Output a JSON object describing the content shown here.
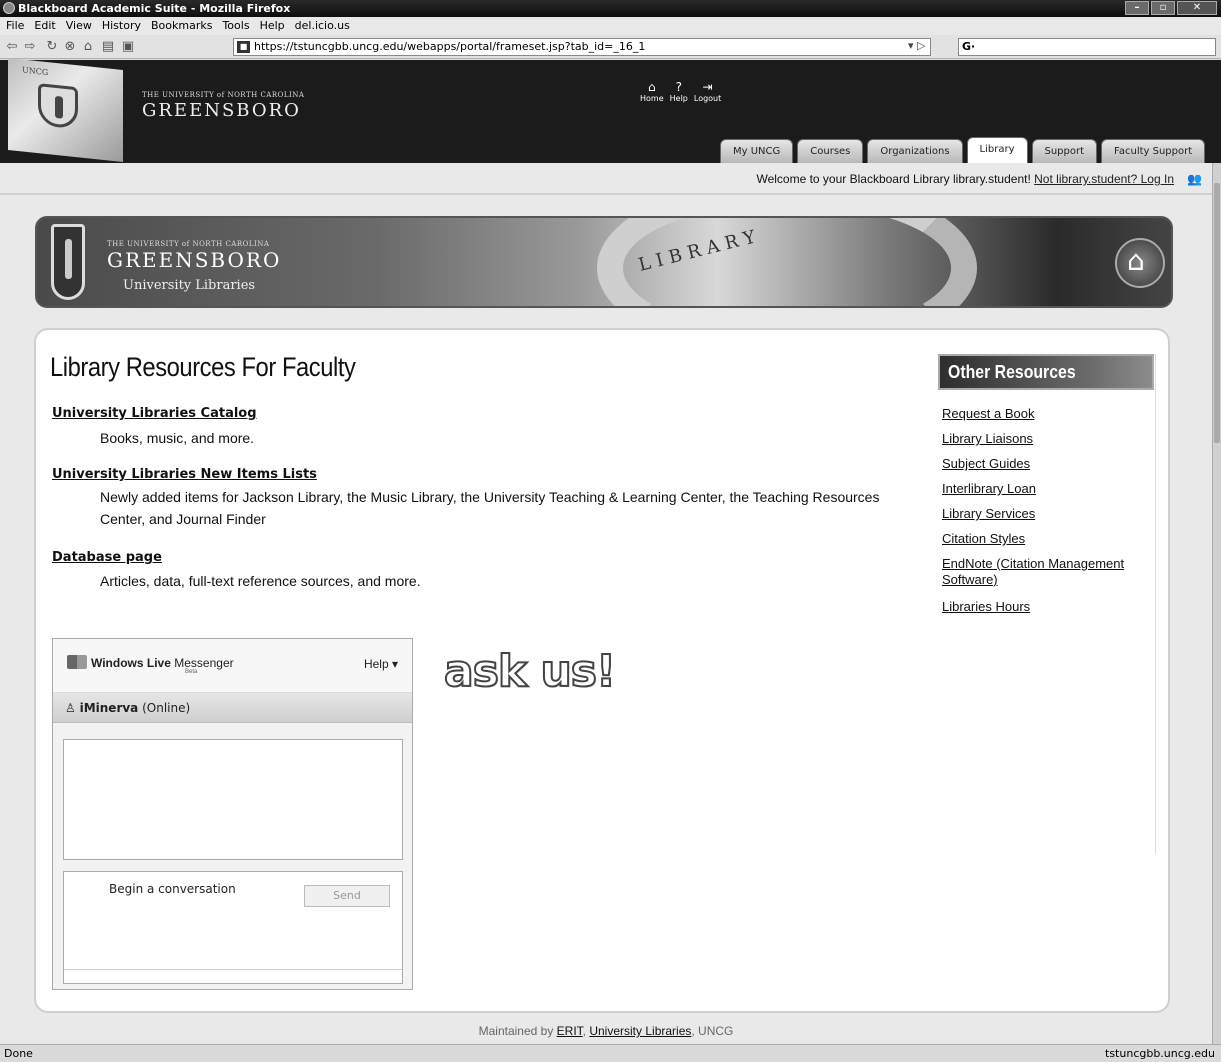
{
  "window": {
    "title": "Blackboard Academic Suite - Mozilla Firefox",
    "controls": [
      "–",
      "▫",
      "✕"
    ]
  },
  "menu": [
    "File",
    "Edit",
    "View",
    "History",
    "Bookmarks",
    "Tools",
    "Help",
    "del.icio.us"
  ],
  "navbar": {
    "url": "https://tstuncgbb.uncg.edu/webapps/portal/frameset.jsp?tab_id=_16_1",
    "search_engine": "G·"
  },
  "header": {
    "institution_small": "THE UNIVERSITY of NORTH CAROLINA",
    "institution_name": "GREENSBORO",
    "flag_text": "UNCG",
    "top_links": [
      {
        "label": "Home",
        "icon": "home-icon"
      },
      {
        "label": "Help",
        "icon": "help-icon"
      },
      {
        "label": "Logout",
        "icon": "logout-icon"
      }
    ],
    "tabs": [
      {
        "label": "My UNCG",
        "active": false
      },
      {
        "label": "Courses",
        "active": false
      },
      {
        "label": "Organizations",
        "active": false
      },
      {
        "label": "Library",
        "active": true
      },
      {
        "label": "Support",
        "active": false
      },
      {
        "label": "Faculty Support",
        "active": false
      }
    ]
  },
  "welcome": {
    "text": "Welcome to your Blackboard Library library.student! ",
    "login_link": "Not library.student? Log In"
  },
  "banner": {
    "small": "THE UNIVERSITY of NORTH CAROLINA",
    "name": "GREENSBORO",
    "sub": "University Libraries",
    "arch_text": "LIBRARY"
  },
  "main": {
    "title": "Library Resources For Faculty",
    "resources": [
      {
        "link": "University Libraries Catalog",
        "desc": "Books, music, and more."
      },
      {
        "link": "University Libraries New Items Lists",
        "desc": "Newly added items for Jackson Library, the Music Library, the University Teaching & Learning Center, the Teaching Resources Center, and Journal Finder"
      },
      {
        "link": "Database page",
        "desc": "Articles, data, full-text reference sources, and more."
      }
    ]
  },
  "other_resources": {
    "title": "Other Resources",
    "links": [
      "Request a Book",
      "Library Liaisons",
      "Subject Guides",
      "Interlibrary Loan",
      "Library Services",
      "Citation Styles",
      "EndNote (Citation Management Software)",
      "Libraries Hours"
    ]
  },
  "messenger": {
    "brand_windows": "Windows Live",
    "brand_messenger": "Messenger",
    "beta": "Beta",
    "help": "Help ▾",
    "contact": "iMinerva",
    "presence": "(Online)",
    "prompt": "Begin a conversation",
    "send": "Send"
  },
  "askus": "ask us!",
  "footer": {
    "prefix": "Maintained by ",
    "erit": "ERIT",
    "libs": "University Libraries",
    "suffix": ", UNCG"
  },
  "status": {
    "left": "Done",
    "right": "tstuncgbb.uncg.edu"
  }
}
